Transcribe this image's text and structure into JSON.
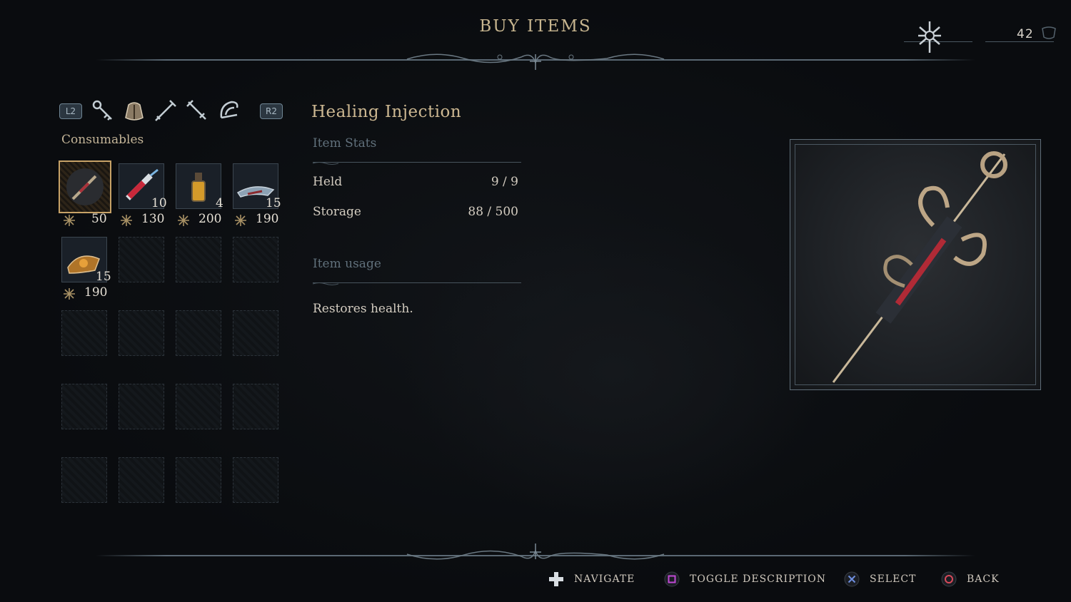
{
  "screen": {
    "title": "BUY ITEMS"
  },
  "currency": {
    "amount": "42",
    "icon": "bone-emblem-icon"
  },
  "tabs": {
    "left_button": "L2",
    "right_button": "R2",
    "icons": [
      "key-icon",
      "pouch-icon",
      "sword-icon",
      "syringe-icon",
      "claw-icon"
    ],
    "active_index": 1
  },
  "category": {
    "label": "Consumables"
  },
  "items": [
    {
      "name": "healing-injection",
      "qty": "",
      "price": "50",
      "selected": true
    },
    {
      "name": "blood-vial",
      "qty": "10",
      "price": "130"
    },
    {
      "name": "elixir-bottle",
      "qty": "4",
      "price": "200"
    },
    {
      "name": "throwing-knife",
      "qty": "15",
      "price": "190"
    },
    {
      "name": "fire-bomb",
      "qty": "15",
      "price": "190"
    }
  ],
  "detail": {
    "name": "Healing Injection",
    "stats_heading": "Item Stats",
    "held_label": "Held",
    "held_value": "9 / 9",
    "storage_label": "Storage",
    "storage_value": "88 / 500",
    "usage_heading": "Item usage",
    "description": "Restores health."
  },
  "footer": {
    "navigate": "NAVIGATE",
    "toggle": "TOGGLE DESCRIPTION",
    "select": "SELECT",
    "back": "BACK"
  },
  "colors": {
    "accent": "#c7b58f",
    "selection": "#c7a267",
    "square": "#c24ad6",
    "cross": "#6f8fe0",
    "circle": "#d94a5a"
  }
}
